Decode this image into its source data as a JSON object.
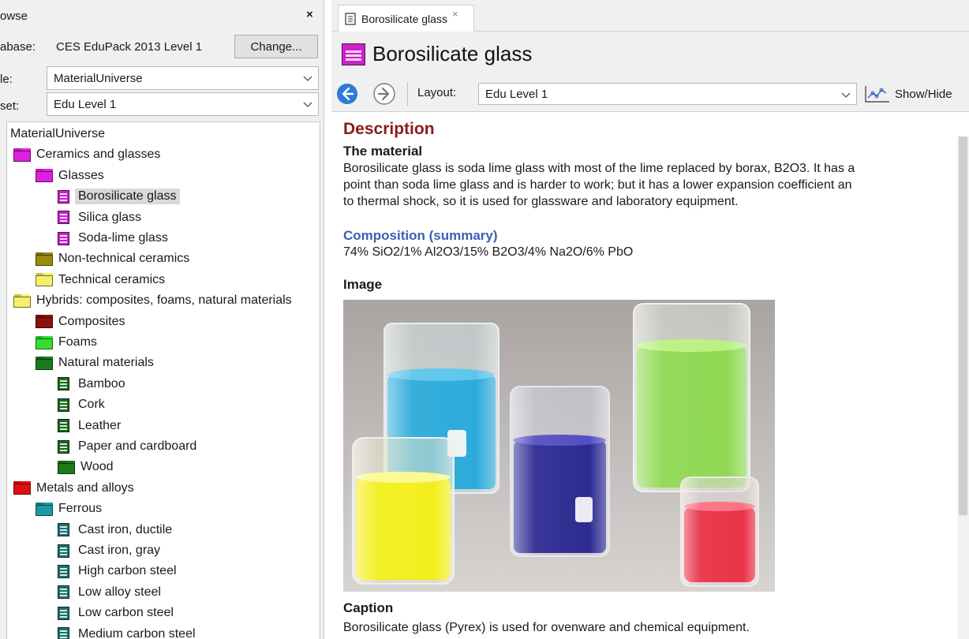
{
  "browse": {
    "title": "owse",
    "close_glyph": "×",
    "database_label": "abase:",
    "database_value": "CES EduPack 2013 Level 1",
    "change_button": "Change...",
    "table_label": "le:",
    "table_value": "MaterialUniverse",
    "subset_label": "set:",
    "subset_value": "Edu Level 1"
  },
  "tree": [
    {
      "label": "MaterialUniverse",
      "kind": "root",
      "level": 0
    },
    {
      "label": "Ceramics and glasses",
      "kind": "folder",
      "level": 0,
      "color": "#e020e0"
    },
    {
      "label": "Glasses",
      "kind": "folder",
      "level": 1,
      "color": "#e020e0"
    },
    {
      "label": "Borosilicate glass",
      "kind": "doc",
      "level": 2,
      "color": "#c81fc8",
      "selected": true
    },
    {
      "label": "Silica glass",
      "kind": "doc",
      "level": 2,
      "color": "#c81fc8"
    },
    {
      "label": "Soda-lime glass",
      "kind": "doc",
      "level": 2,
      "color": "#c81fc8"
    },
    {
      "label": "Non-technical ceramics",
      "kind": "folder",
      "level": 1,
      "color": "#9a8a10"
    },
    {
      "label": "Technical ceramics",
      "kind": "folder",
      "level": 1,
      "color": "#f5f06a"
    },
    {
      "label": "Hybrids: composites, foams, natural materials",
      "kind": "folder",
      "level": 0,
      "color": "#f5f06a"
    },
    {
      "label": "Composites",
      "kind": "folder",
      "level": 1,
      "color": "#8b1010"
    },
    {
      "label": "Foams",
      "kind": "folder",
      "level": 1,
      "color": "#33dd33"
    },
    {
      "label": "Natural materials",
      "kind": "folder",
      "level": 1,
      "color": "#1a7a1a"
    },
    {
      "label": "Bamboo",
      "kind": "doc",
      "level": 2,
      "color": "#1a6a1a"
    },
    {
      "label": "Cork",
      "kind": "doc",
      "level": 2,
      "color": "#1a6a1a"
    },
    {
      "label": "Leather",
      "kind": "doc",
      "level": 2,
      "color": "#1a6a1a"
    },
    {
      "label": "Paper and cardboard",
      "kind": "doc",
      "level": 2,
      "color": "#1a6a1a"
    },
    {
      "label": "Wood",
      "kind": "folder",
      "level": 2,
      "color": "#1a7a1a"
    },
    {
      "label": "Metals and alloys",
      "kind": "folder",
      "level": 0,
      "color": "#e01010"
    },
    {
      "label": "Ferrous",
      "kind": "folder",
      "level": 1,
      "color": "#1a9aa0"
    },
    {
      "label": "Cast iron, ductile",
      "kind": "doc",
      "level": 2,
      "color": "#1a7070"
    },
    {
      "label": "Cast iron, gray",
      "kind": "doc",
      "level": 2,
      "color": "#1a7070"
    },
    {
      "label": "High carbon steel",
      "kind": "doc",
      "level": 2,
      "color": "#1a7070"
    },
    {
      "label": "Low alloy steel",
      "kind": "doc",
      "level": 2,
      "color": "#1a7070"
    },
    {
      "label": "Low carbon steel",
      "kind": "doc",
      "level": 2,
      "color": "#1a7070"
    },
    {
      "label": "Medium carbon steel",
      "kind": "doc",
      "level": 2,
      "color": "#1a7070"
    }
  ],
  "tab": {
    "label": "Borosilicate glass",
    "close_glyph": "×"
  },
  "record": {
    "title": "Borosilicate glass",
    "icon_color": "#cc22cc"
  },
  "navbar": {
    "layout_label": "Layout:",
    "layout_value": "Edu Level 1",
    "show_hide_label": "Show/Hide"
  },
  "content": {
    "description_heading": "Description",
    "material_heading": "The material",
    "material_lines": [
      "Borosilicate glass is soda lime glass with most of the lime replaced by borax, B2O3. It has a",
      "point than soda lime glass and is harder to work; but it has a lower expansion coefficient an",
      "to thermal shock, so it is used for glassware and laboratory equipment."
    ],
    "composition_heading": "Composition (summary)",
    "composition_value": "74% SiO2/1% Al2O3/15% B2O3/4% Na2O/6% PbO",
    "image_heading": "Image",
    "caption_heading": "Caption",
    "caption_value": "Borosilicate glass (Pyrex) is used for ovenware and chemical equipment."
  },
  "colors": {
    "description": "#8b1a1a",
    "composition": "#3a5fb5",
    "nav_back": "#2e7bd6"
  }
}
